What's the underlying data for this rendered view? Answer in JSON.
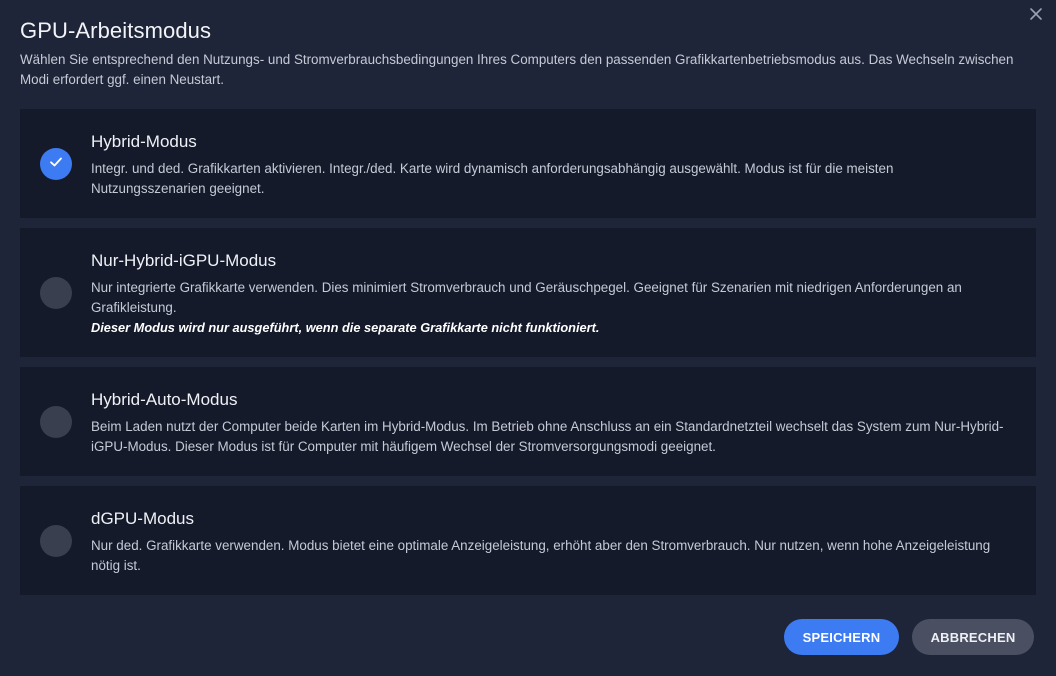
{
  "dialog": {
    "title": "GPU-Arbeitsmodus",
    "description": "Wählen Sie entsprechend den Nutzungs- und Stromverbrauchsbedingungen Ihres Computers den passenden Grafikkartenbetriebsmodus aus. Das Wechseln zwischen Modi erfordert ggf. einen Neustart.",
    "close_icon": "close-icon"
  },
  "options": [
    {
      "title": "Hybrid-Modus",
      "description": "Integr. und ded. Grafikkarten aktivieren. Integr./ded. Karte wird dynamisch anforderungsabhängig ausgewählt. Modus ist für die meisten Nutzungsszenarien geeignet.",
      "note": "",
      "selected": true
    },
    {
      "title": "Nur-Hybrid-iGPU-Modus",
      "description": "Nur integrierte Grafikkarte verwenden. Dies minimiert Stromverbrauch und Geräuschpegel. Geeignet für Szenarien mit niedrigen Anforderungen an Grafikleistung.",
      "note": "Dieser Modus wird nur ausgeführt, wenn die separate Grafikkarte nicht funktioniert.",
      "selected": false
    },
    {
      "title": "Hybrid-Auto-Modus",
      "description": "Beim Laden nutzt der Computer beide Karten im Hybrid-Modus. Im Betrieb ohne Anschluss an ein Standardnetzteil wechselt das System zum Nur-Hybrid-iGPU-Modus. Dieser Modus ist für Computer mit häufigem Wechsel der Stromversorgungsmodi geeignet.",
      "note": "",
      "selected": false
    },
    {
      "title": "dGPU-Modus",
      "description": "Nur ded. Grafikkarte verwenden. Modus bietet eine optimale Anzeigeleistung, erhöht aber den Stromverbrauch. Nur nutzen, wenn hohe Anzeigeleistung nötig ist.",
      "note": "",
      "selected": false
    }
  ],
  "buttons": {
    "save_label": "SPEICHERN",
    "cancel_label": "ABBRECHEN"
  },
  "colors": {
    "accent": "#3d7bf3",
    "background": "#1f2538",
    "card": "#151a2b"
  }
}
